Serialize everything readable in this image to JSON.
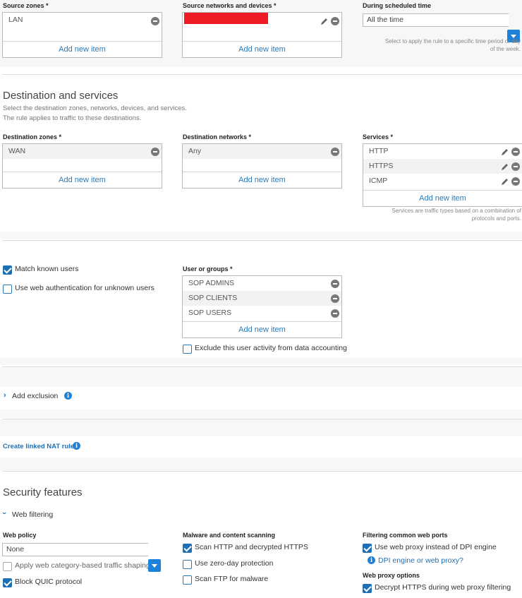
{
  "source": {
    "zones_label": "Source zones *",
    "zones_items": [
      "LAN"
    ],
    "networks_label": "Source networks and devices *",
    "networks_redacted_color": "#ee1c25",
    "add_new_item": "Add new item",
    "schedule_label": "During scheduled time",
    "schedule_value": "All the time",
    "schedule_hint": "Select to apply the rule to a specific time period or day of the week."
  },
  "destination": {
    "title": "Destination and services",
    "desc1": "Select the destination zones, networks, devices, and services.",
    "desc2": "The rule applies to traffic to these destinations.",
    "zones_label": "Destination zones *",
    "zones_items": [
      "WAN"
    ],
    "networks_label": "Destination networks *",
    "networks_items": [
      "Any"
    ],
    "services_label": "Services *",
    "services_items": [
      "HTTP",
      "HTTPS",
      "ICMP"
    ],
    "services_hint": "Services are traffic types based on a combination of protocols and ports.",
    "add_new_item": "Add new item"
  },
  "users": {
    "match_known": "Match known users",
    "web_auth": "Use web authentication for unknown users",
    "groups_label": "User or groups *",
    "groups_items": [
      "SOP ADMINS",
      "SOP CLIENTS",
      "SOP USERS"
    ],
    "add_new_item": "Add new item",
    "exclude_accounting": "Exclude this user activity from data accounting"
  },
  "exclusion": {
    "label": "Add exclusion"
  },
  "nat": {
    "label": "Create linked NAT rule"
  },
  "security": {
    "title": "Security features",
    "web_filtering": "Web filtering",
    "web_policy_label": "Web policy",
    "web_policy_value": "None",
    "traffic_shaping": "Apply web category-based traffic shaping",
    "block_quic": "Block QUIC protocol",
    "malware_label": "Malware and content scanning",
    "scan_http": "Scan HTTP and decrypted HTTPS",
    "zero_day": "Use zero-day protection",
    "scan_ftp": "Scan FTP for malware",
    "ports_label": "Filtering common web ports",
    "web_proxy": "Use web proxy instead of DPI engine",
    "dpi_link": "DPI engine or web proxy?",
    "proxy_options_label": "Web proxy options",
    "decrypt_https": "Decrypt HTTPS during web proxy filtering"
  },
  "colors": {
    "accent": "#1e6fb5",
    "button": "#1e82d8",
    "link": "#2a7ab8"
  }
}
